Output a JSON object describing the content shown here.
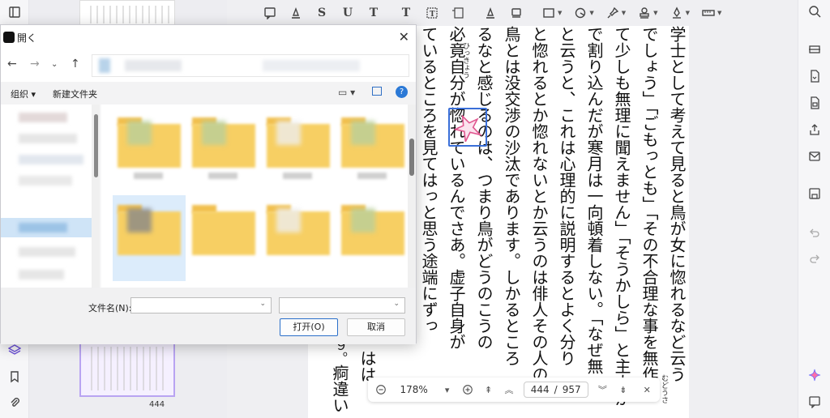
{
  "dialog": {
    "title": "開く",
    "new_folder_label": "新建文件夹",
    "organize_label": "组织",
    "filename_label": "文件名(N):",
    "filename_value": "",
    "open_label": "打开(O)",
    "cancel_label": "取消",
    "help_label": "?"
  },
  "thumbnail": {
    "page_number": "444"
  },
  "nav": {
    "zoom": "178%",
    "current_page": "444",
    "separator": "/",
    "total_pages": "957"
  },
  "document": {
    "columns": [
      "学士として考えて見ると鳥が女に惚れるなど云う",
      "でしょう」「ごもっとも」「その不合理な事を無作",
      "て少しも無理に聞えません」「そうかしら」と主人が",
      "で割り込んだが寒月は一向頓着しない。「なぜ無",
      "と云うと、これは心理的に説明するとよく分り",
      "と惚れるとか惚れないとか云うのは俳人その人の存",
      "鳥とは没交渉の沙汰であります。しかるところ",
      "るなと感じるのは、つまり鳥がどうのこうの",
      "必竟自分が惚れているんでさあ。虚子自身が",
      "ているところを見てはっと思う途端にずっ",
      "痾違い",
      "はは",
      "９。"
    ],
    "ruby_hikkyou": "ひっきょう",
    "ruby_mudousa": "むどうさ"
  },
  "colors": {
    "accent": "#3a6fd8",
    "stamp": "#e0568f",
    "selection": "#b9a4f2"
  }
}
